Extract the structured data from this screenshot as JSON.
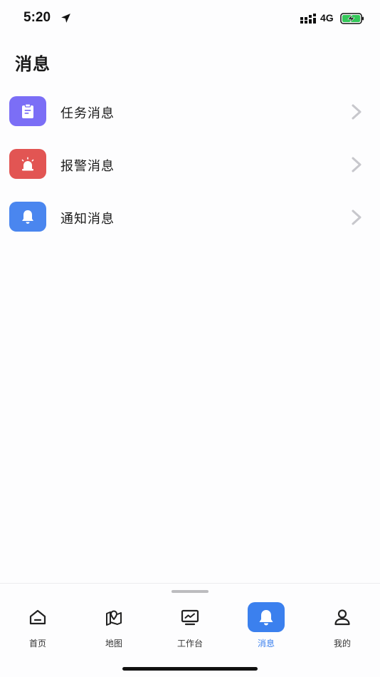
{
  "status_bar": {
    "time": "5:20",
    "network": "4G",
    "icons": [
      "location-arrow-icon",
      "signal-icon",
      "battery-charging-icon"
    ]
  },
  "header": {
    "title": "消息"
  },
  "messages": [
    {
      "label": "任务消息",
      "icon": "clipboard-icon",
      "color": "#7b6ef6"
    },
    {
      "label": "报警消息",
      "icon": "alarm-siren-icon",
      "color": "#e25553"
    },
    {
      "label": "通知消息",
      "icon": "bell-icon",
      "color": "#4a86ef"
    }
  ],
  "tabs": [
    {
      "label": "首页",
      "icon": "home-icon",
      "active": false
    },
    {
      "label": "地图",
      "icon": "map-icon",
      "active": false
    },
    {
      "label": "工作台",
      "icon": "workbench-icon",
      "active": false
    },
    {
      "label": "消息",
      "icon": "bell-icon",
      "active": true
    },
    {
      "label": "我的",
      "icon": "user-icon",
      "active": false
    }
  ],
  "colors": {
    "accent": "#3b80ee",
    "battery": "#34c759"
  }
}
